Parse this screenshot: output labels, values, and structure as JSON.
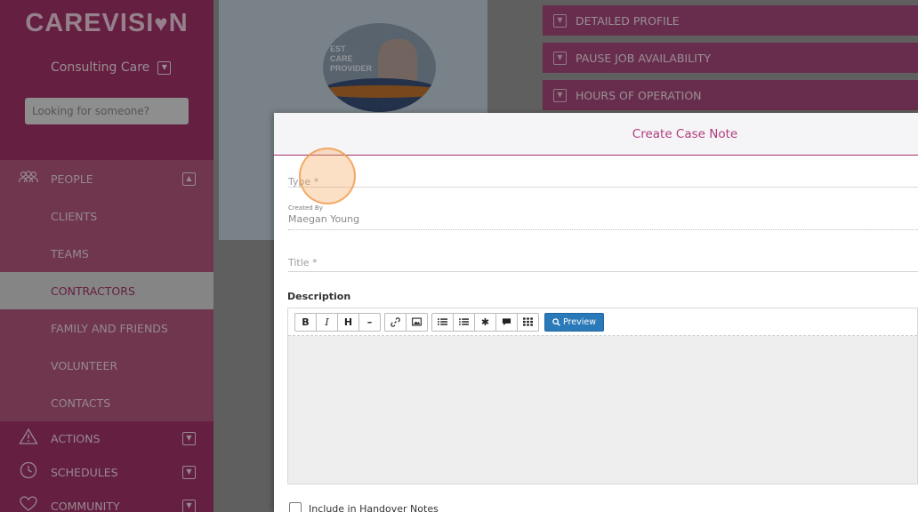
{
  "sidebar": {
    "logo_text": "CAREVISI",
    "logo_tail": "N",
    "org_name": "Consulting Care",
    "search_placeholder": "Looking for someone?",
    "people": {
      "label": "PEOPLE",
      "icon": "people-icon"
    },
    "people_items": [
      {
        "label": "CLIENTS"
      },
      {
        "label": "TEAMS"
      },
      {
        "label": "CONTRACTORS",
        "active": true
      },
      {
        "label": "FAMILY AND FRIENDS"
      },
      {
        "label": "VOLUNTEER"
      },
      {
        "label": "CONTACTS"
      }
    ],
    "main_items": [
      {
        "label": "ACTIONS",
        "icon": "warning-icon"
      },
      {
        "label": "SCHEDULES",
        "icon": "clock-icon"
      },
      {
        "label": "COMMUNITY",
        "icon": "heart-icon"
      }
    ]
  },
  "background": {
    "avatar_text": "EST\nCARE\nPROVIDER",
    "accordions": [
      {
        "label": "DETAILED PROFILE"
      },
      {
        "label": "PAUSE JOB AVAILABILITY"
      },
      {
        "label": "HOURS OF OPERATION"
      }
    ]
  },
  "modal": {
    "title": "Create Case Note",
    "type_placeholder": "Type *",
    "created_by_label": "Created By",
    "created_by_value": "Maegan Young",
    "title_placeholder": "Title *",
    "description_label": "Description",
    "toolbar": {
      "bold": "B",
      "italic": "I",
      "heading": "H",
      "hr": "–",
      "preview": "Preview"
    },
    "handover_label": "Include in Handover Notes"
  },
  "colors": {
    "brand": "#a3336a",
    "accent_title": "#b13b7c",
    "preview_button": "#2a7ab9"
  }
}
